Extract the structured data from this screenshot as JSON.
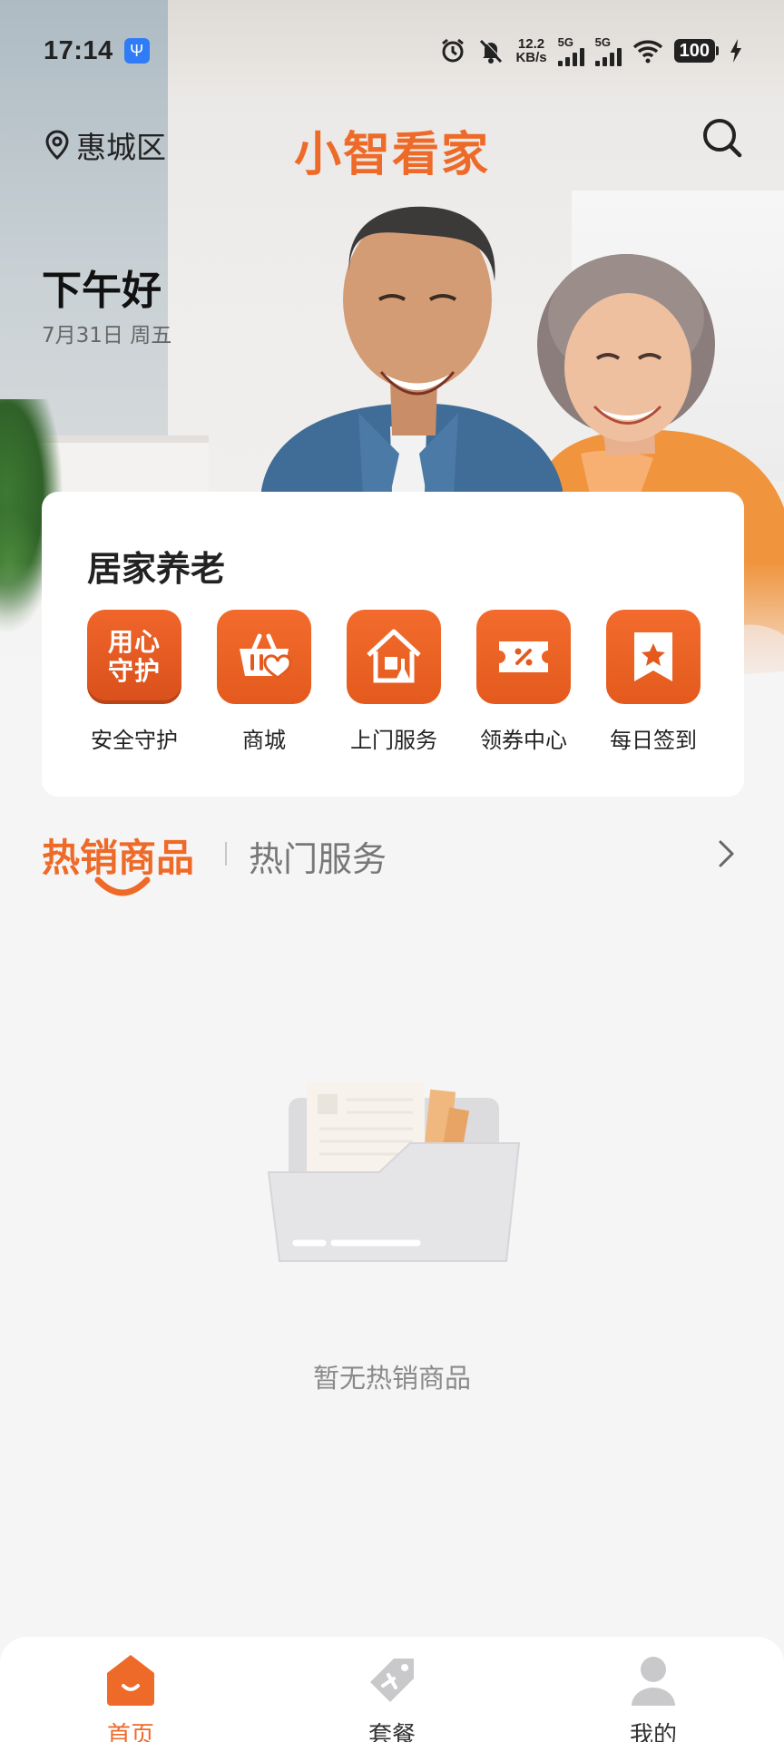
{
  "status_bar": {
    "time": "17:14",
    "net_speed_value": "12.2",
    "net_speed_unit": "KB/s",
    "signal_1": "5G",
    "signal_2": "5G",
    "battery": "100"
  },
  "header": {
    "location": "惠城区",
    "app_title": "小智看家"
  },
  "greeting": {
    "text": "下午好",
    "date": "7月31日 周五"
  },
  "service_card": {
    "title": "居家养老",
    "guard_icon_text_line1": "用心",
    "guard_icon_text_line2": "守护",
    "items": [
      {
        "label": "安全守护",
        "icon": "guard-icon"
      },
      {
        "label": "商城",
        "icon": "shopping-basket-icon"
      },
      {
        "label": "上门服务",
        "icon": "home-service-icon"
      },
      {
        "label": "领券中心",
        "icon": "coupon-icon"
      },
      {
        "label": "每日签到",
        "icon": "checkin-bookmark-icon"
      }
    ]
  },
  "tabs": {
    "hot_products": "热销商品",
    "hot_services": "热门服务"
  },
  "empty_state": {
    "message": "暂无热销商品"
  },
  "bottom_nav": {
    "items": [
      {
        "label": "首页",
        "icon": "home-icon",
        "active": true
      },
      {
        "label": "套餐",
        "icon": "package-tag-icon",
        "active": false
      },
      {
        "label": "我的",
        "icon": "user-icon",
        "active": false
      }
    ]
  },
  "colors": {
    "accent": "#ee6a28",
    "background": "#f5f5f5",
    "card": "#ffffff"
  }
}
